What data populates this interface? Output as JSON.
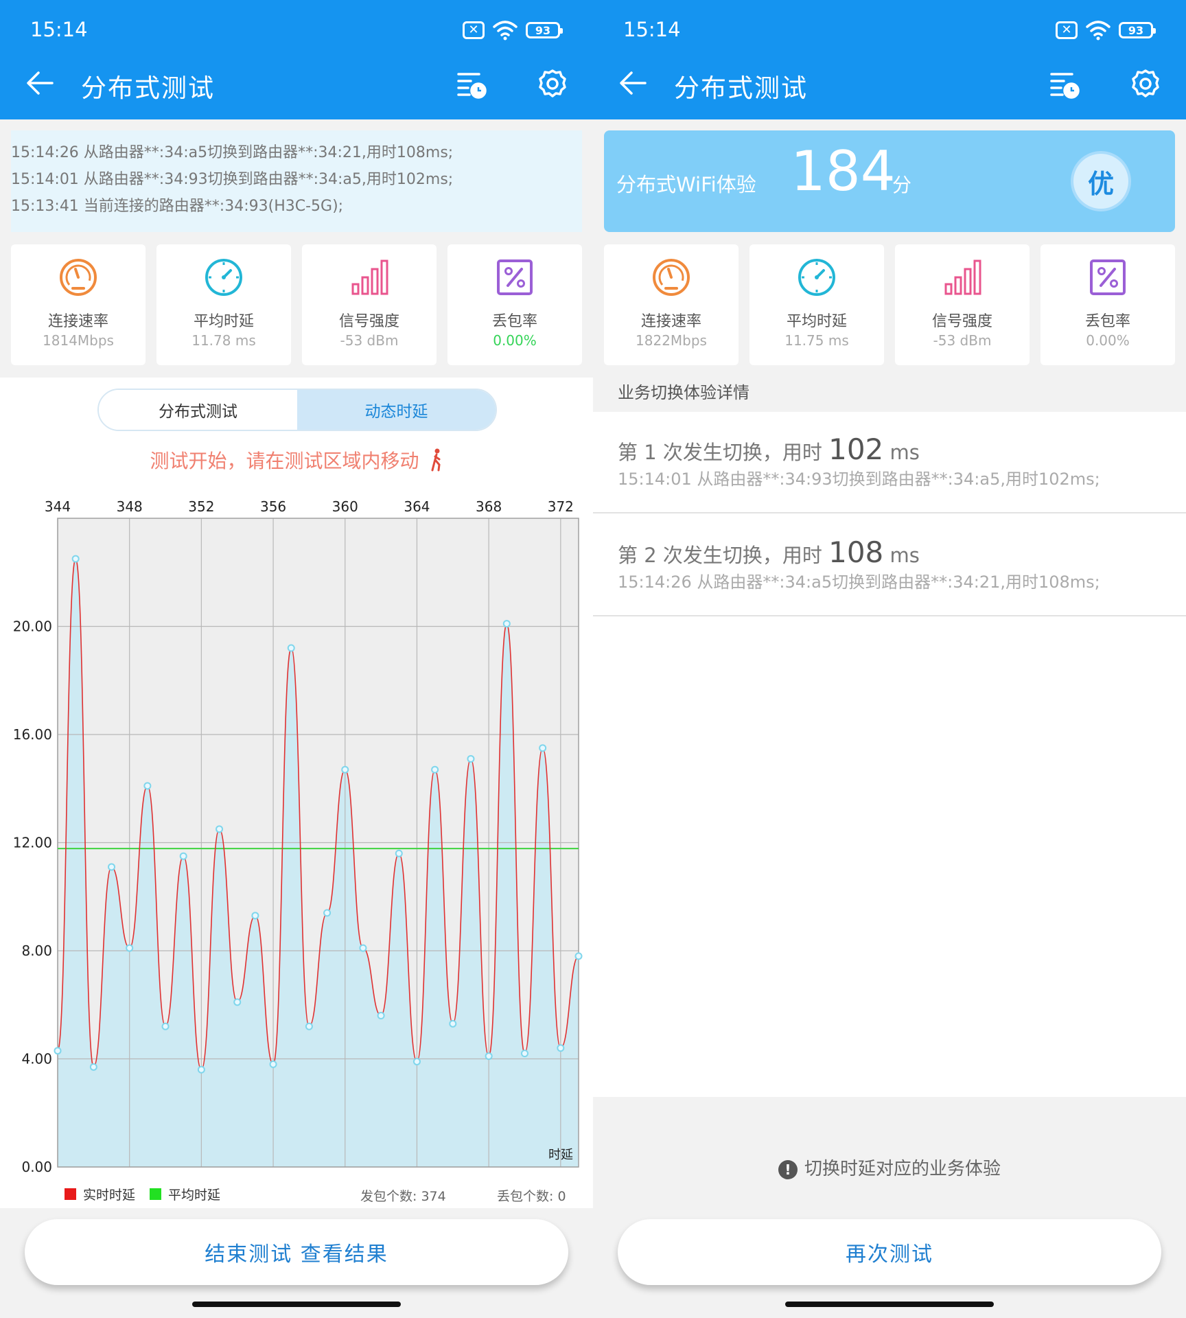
{
  "left_screen": {
    "status": {
      "time": "15:14",
      "battery": "93"
    },
    "title": "分布式测试",
    "log_lines": [
      "15:14:26 从路由器**:34:a5切换到路由器**:34:21,用时108ms;",
      "15:14:01 从路由器**:34:93切换到路由器**:34:a5,用时102ms;",
      "15:13:41 当前连接的路由器**:34:93(H3C-5G);"
    ],
    "metrics": [
      {
        "label": "连接速率",
        "value": "1814Mbps",
        "icon": "speedometer-icon",
        "color": "#f08a3c"
      },
      {
        "label": "平均时延",
        "value": "11.78 ms",
        "icon": "clock-icon",
        "color": "#22b6d6"
      },
      {
        "label": "信号强度",
        "value": "-53 dBm",
        "icon": "signal-bars-icon",
        "color": "#e9558e"
      },
      {
        "label": "丢包率",
        "value": "0.00%",
        "icon": "percent-icon",
        "color": "#9b5fd6"
      }
    ],
    "tabs": [
      "分布式测试",
      "动态时延"
    ],
    "active_tab": "动态时延",
    "notice": "测试开始，请在测试区域内移动",
    "legend": {
      "realtime": "实时时延",
      "average": "平均时延",
      "packets_sent": "发包个数: 374",
      "packets_lost": "丢包个数: 0"
    },
    "button": "结束测试  查看结果"
  },
  "right_screen": {
    "status": {
      "time": "15:14",
      "battery": "93"
    },
    "title": "分布式测试",
    "score": {
      "label": "分布式WiFi体验",
      "value": "184",
      "unit": "分",
      "grade": "优"
    },
    "metrics": [
      {
        "label": "连接速率",
        "value": "1822Mbps",
        "icon": "speedometer-icon"
      },
      {
        "label": "平均时延",
        "value": "11.75 ms",
        "icon": "clock-icon"
      },
      {
        "label": "信号强度",
        "value": "-53 dBm",
        "icon": "signal-bars-icon"
      },
      {
        "label": "丢包率",
        "value": "0.00%",
        "icon": "percent-icon"
      }
    ],
    "section_title": "业务切换体验详情",
    "details": [
      {
        "prefix": "第 1 次发生切换，用时 ",
        "value": "102",
        "unit": " ms",
        "desc": "15:14:01 从路由器**:34:93切换到路由器**:34:a5,用时102ms;"
      },
      {
        "prefix": "第 2 次发生切换，用时 ",
        "value": "108",
        "unit": " ms",
        "desc": "15:14:26 从路由器**:34:a5切换到路由器**:34:21,用时108ms;"
      }
    ],
    "hint": "切换时延对应的业务体验",
    "button": "再次测试"
  },
  "chart_data": {
    "type": "line",
    "x_axis_position": "top",
    "x_ticks": [
      344,
      348,
      352,
      356,
      360,
      364,
      368,
      372
    ],
    "y_ticks": [
      "0.00",
      "4.00",
      "8.00",
      "12.00",
      "16.00",
      "20.00"
    ],
    "xlim": [
      344,
      373
    ],
    "ylim": [
      0,
      24
    ],
    "axis_caption": "时延",
    "average": 11.78,
    "series": [
      {
        "name": "实时时延",
        "color": "#e03030",
        "x": [
          344,
          345,
          346,
          347,
          348,
          349,
          350,
          351,
          352,
          353,
          354,
          355,
          356,
          357,
          358,
          359,
          360,
          361,
          362,
          363,
          364,
          365,
          366,
          367,
          368,
          369,
          370,
          371,
          372,
          373
        ],
        "values": [
          4.3,
          22.5,
          3.7,
          11.1,
          8.1,
          14.1,
          5.2,
          11.5,
          3.6,
          12.5,
          6.1,
          9.3,
          3.8,
          19.2,
          5.2,
          9.4,
          14.7,
          8.1,
          5.6,
          11.6,
          3.9,
          14.7,
          5.3,
          15.1,
          4.1,
          20.1,
          4.2,
          15.5,
          4.4,
          7.8
        ]
      },
      {
        "name": "平均时延",
        "color": "#3ed43e"
      }
    ]
  }
}
